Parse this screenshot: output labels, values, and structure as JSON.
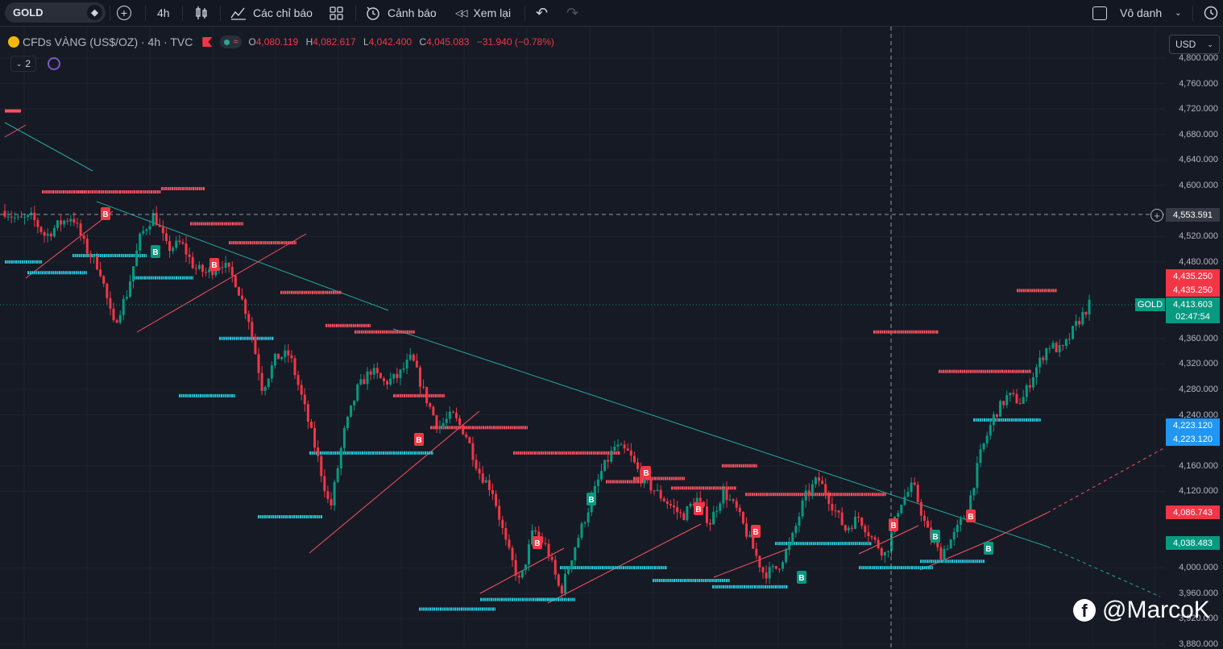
{
  "toolbar": {
    "symbol": "GOLD",
    "interval": "4h",
    "indicators_label": "Các chỉ báo",
    "alerts_label": "Cảnh báo",
    "replay_label": "Xem lại",
    "layout_name": "Vô danh"
  },
  "legend": {
    "title": "CFDs VÀNG (US$/OZ) · 4h · TVC",
    "o_label": "O",
    "o": "4,080.119",
    "h_label": "H",
    "h": "4,082.617",
    "l_label": "L",
    "l": "4,042.400",
    "c_label": "C",
    "c": "4,045.083",
    "change": "−31.940 (−0.78%)",
    "collapse_count": "2"
  },
  "currency": "USD",
  "colors": {
    "up": "#089981",
    "down": "#f23645",
    "support": "#26c6da",
    "resistance": "#f7525f",
    "trend": "#26a69a"
  },
  "price_tags": {
    "crosshair": "4,553.591",
    "res1": "4,435.250",
    "res2": "4,435.250",
    "symbol_tag": "GOLD",
    "last": "4,413.603",
    "countdown": "02:47:54",
    "sup1": "4,223.120",
    "sup2": "4,223.120",
    "red_tag": "4,086.743",
    "green_tag": "4,038.483"
  },
  "watermark": "@MarcoK",
  "chart_data": {
    "type": "candlestick",
    "y_axis": {
      "ticks": [
        "4,800.000",
        "4,760.000",
        "4,720.000",
        "4,680.000",
        "4,640.000",
        "4,600.000",
        "4,520.000",
        "4,480.000",
        "4,360.000",
        "4,320.000",
        "4,280.000",
        "4,240.000",
        "4,160.000",
        "4,120.000",
        "4,000.000",
        "3,960.000",
        "3,920.000",
        "3,880.000"
      ],
      "range": [
        3880,
        4800
      ]
    },
    "price_path": [
      4560,
      4545,
      4550,
      4520,
      4540,
      4552,
      4500,
      4470,
      4380,
      4430,
      4520,
      4555,
      4500,
      4510,
      4470,
      4462,
      4480,
      4450,
      4390,
      4280,
      4330,
      4335,
      4260,
      4180,
      4090,
      4210,
      4280,
      4310,
      4290,
      4300,
      4330,
      4270,
      4220,
      4240,
      4210,
      4150,
      4120,
      4035,
      3975,
      4060,
      4030,
      3960,
      4030,
      4090,
      4150,
      4190,
      4180,
      4140,
      4120,
      4100,
      4080,
      4110,
      4070,
      4120,
      4090,
      4040,
      3990,
      4000,
      4040,
      4110,
      4140,
      4100,
      4060,
      4080,
      4045,
      4020,
      4100,
      4130,
      4060,
      4020,
      4050,
      4090,
      4180,
      4240,
      4270,
      4260,
      4310,
      4350,
      4340,
      4380,
      4413
    ],
    "support_levels": [
      4480,
      4463,
      4490,
      4455,
      4270,
      4360,
      4080,
      4180,
      3935,
      3950,
      3950,
      4000,
      3980,
      3970,
      4038,
      4000,
      4010,
      4232
    ],
    "resistance_levels": [
      4590,
      4590,
      4595,
      4540,
      4510,
      4432,
      4380,
      4370,
      4270,
      4220,
      4180,
      4135,
      4140,
      4125,
      4160,
      4115,
      4115,
      4370,
      4308,
      4435
    ],
    "signals": [
      {
        "label": "B",
        "kind": "sell"
      },
      {
        "label": "B",
        "kind": "buy"
      },
      {
        "label": "B",
        "kind": "sell"
      },
      {
        "label": "B",
        "kind": "sell"
      },
      {
        "label": "B",
        "kind": "buy"
      },
      {
        "label": "B",
        "kind": "sell"
      },
      {
        "label": "B",
        "kind": "sell"
      },
      {
        "label": "B",
        "kind": "sell"
      },
      {
        "label": "B",
        "kind": "sell"
      },
      {
        "label": "B",
        "kind": "buy"
      },
      {
        "label": "B",
        "kind": "sell"
      },
      {
        "label": "B",
        "kind": "buy"
      },
      {
        "label": "B",
        "kind": "sell"
      },
      {
        "label": "B",
        "kind": "buy"
      }
    ]
  }
}
